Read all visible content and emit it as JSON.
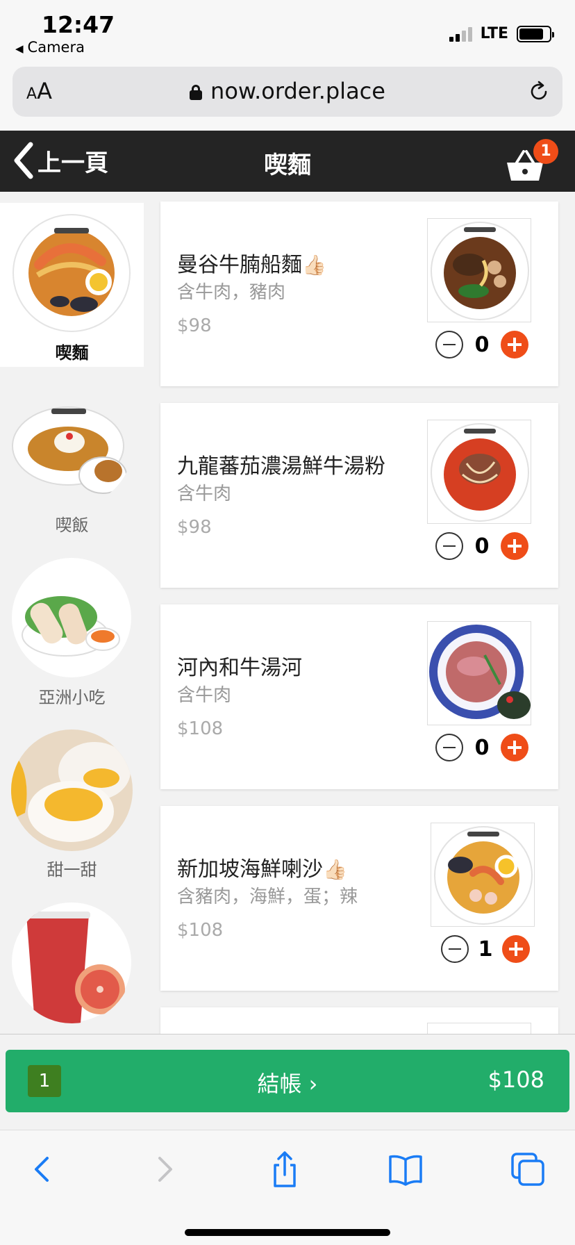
{
  "status_bar": {
    "time": "12:47",
    "back_app": "Camera",
    "network": "LTE"
  },
  "browser": {
    "text_size_label_small": "A",
    "text_size_label_large": "A",
    "url": "now.order.place"
  },
  "header": {
    "back_label": "上一頁",
    "title": "喫麵",
    "cart_count": "1"
  },
  "categories": [
    {
      "label": "喫麵",
      "active": true
    },
    {
      "label": "喫飯",
      "active": false
    },
    {
      "label": "亞洲小吃",
      "active": false
    },
    {
      "label": "甜一甜",
      "active": false
    },
    {
      "label": "",
      "active": false
    }
  ],
  "products": [
    {
      "name": "曼谷牛腩船麵",
      "recommended": true,
      "description": "含牛肉，豬肉",
      "price": "$98",
      "quantity": "0"
    },
    {
      "name": "九龍蕃茄濃湯鮮牛湯粉",
      "recommended": false,
      "description": "含牛肉",
      "price": "$98",
      "quantity": "0"
    },
    {
      "name": "河內和牛湯河",
      "recommended": false,
      "description": "含牛肉",
      "price": "$108",
      "quantity": "0"
    },
    {
      "name": "新加坡海鮮喇沙",
      "recommended": true,
      "description": "含豬肉，海鮮，蛋；辣",
      "price": "$108",
      "quantity": "1"
    }
  ],
  "checkout": {
    "count": "1",
    "label": "結帳 ›",
    "total": "$108"
  },
  "icons": {
    "recommended": "thumbs-up-icon",
    "cart": "basket-icon",
    "toolbar": [
      "back-icon",
      "forward-icon",
      "share-icon",
      "bookmarks-icon",
      "tabs-icon"
    ]
  },
  "colors": {
    "header_bg": "#242424",
    "accent": "#ef4d18",
    "checkout_bg": "#22ad6a",
    "checkout_count_bg": "#3e7f20",
    "ios_blue": "#1a7cf5"
  }
}
